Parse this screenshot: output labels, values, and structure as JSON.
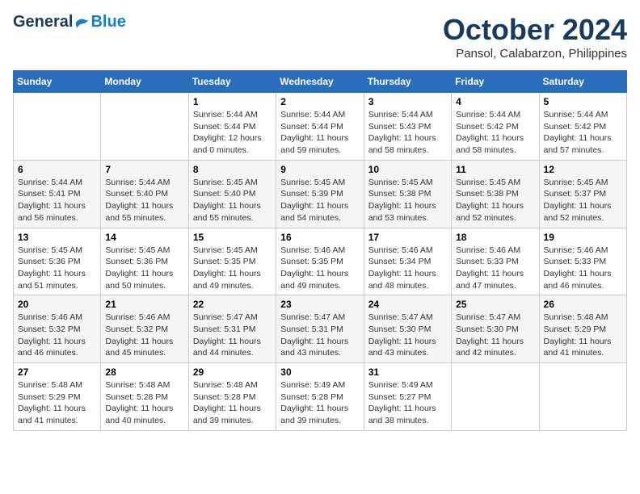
{
  "header": {
    "logo_general": "General",
    "logo_blue": "Blue",
    "month_title": "October 2024",
    "location": "Pansol, Calabarzon, Philippines"
  },
  "weekdays": [
    "Sunday",
    "Monday",
    "Tuesday",
    "Wednesday",
    "Thursday",
    "Friday",
    "Saturday"
  ],
  "weeks": [
    [
      {
        "day": "",
        "info": ""
      },
      {
        "day": "",
        "info": ""
      },
      {
        "day": "1",
        "info": "Sunrise: 5:44 AM\nSunset: 5:44 PM\nDaylight: 12 hours\nand 0 minutes."
      },
      {
        "day": "2",
        "info": "Sunrise: 5:44 AM\nSunset: 5:44 PM\nDaylight: 11 hours\nand 59 minutes."
      },
      {
        "day": "3",
        "info": "Sunrise: 5:44 AM\nSunset: 5:43 PM\nDaylight: 11 hours\nand 58 minutes."
      },
      {
        "day": "4",
        "info": "Sunrise: 5:44 AM\nSunset: 5:42 PM\nDaylight: 11 hours\nand 58 minutes."
      },
      {
        "day": "5",
        "info": "Sunrise: 5:44 AM\nSunset: 5:42 PM\nDaylight: 11 hours\nand 57 minutes."
      }
    ],
    [
      {
        "day": "6",
        "info": "Sunrise: 5:44 AM\nSunset: 5:41 PM\nDaylight: 11 hours\nand 56 minutes."
      },
      {
        "day": "7",
        "info": "Sunrise: 5:44 AM\nSunset: 5:40 PM\nDaylight: 11 hours\nand 55 minutes."
      },
      {
        "day": "8",
        "info": "Sunrise: 5:45 AM\nSunset: 5:40 PM\nDaylight: 11 hours\nand 55 minutes."
      },
      {
        "day": "9",
        "info": "Sunrise: 5:45 AM\nSunset: 5:39 PM\nDaylight: 11 hours\nand 54 minutes."
      },
      {
        "day": "10",
        "info": "Sunrise: 5:45 AM\nSunset: 5:38 PM\nDaylight: 11 hours\nand 53 minutes."
      },
      {
        "day": "11",
        "info": "Sunrise: 5:45 AM\nSunset: 5:38 PM\nDaylight: 11 hours\nand 52 minutes."
      },
      {
        "day": "12",
        "info": "Sunrise: 5:45 AM\nSunset: 5:37 PM\nDaylight: 11 hours\nand 52 minutes."
      }
    ],
    [
      {
        "day": "13",
        "info": "Sunrise: 5:45 AM\nSunset: 5:36 PM\nDaylight: 11 hours\nand 51 minutes."
      },
      {
        "day": "14",
        "info": "Sunrise: 5:45 AM\nSunset: 5:36 PM\nDaylight: 11 hours\nand 50 minutes."
      },
      {
        "day": "15",
        "info": "Sunrise: 5:45 AM\nSunset: 5:35 PM\nDaylight: 11 hours\nand 49 minutes."
      },
      {
        "day": "16",
        "info": "Sunrise: 5:46 AM\nSunset: 5:35 PM\nDaylight: 11 hours\nand 49 minutes."
      },
      {
        "day": "17",
        "info": "Sunrise: 5:46 AM\nSunset: 5:34 PM\nDaylight: 11 hours\nand 48 minutes."
      },
      {
        "day": "18",
        "info": "Sunrise: 5:46 AM\nSunset: 5:33 PM\nDaylight: 11 hours\nand 47 minutes."
      },
      {
        "day": "19",
        "info": "Sunrise: 5:46 AM\nSunset: 5:33 PM\nDaylight: 11 hours\nand 46 minutes."
      }
    ],
    [
      {
        "day": "20",
        "info": "Sunrise: 5:46 AM\nSunset: 5:32 PM\nDaylight: 11 hours\nand 46 minutes."
      },
      {
        "day": "21",
        "info": "Sunrise: 5:46 AM\nSunset: 5:32 PM\nDaylight: 11 hours\nand 45 minutes."
      },
      {
        "day": "22",
        "info": "Sunrise: 5:47 AM\nSunset: 5:31 PM\nDaylight: 11 hours\nand 44 minutes."
      },
      {
        "day": "23",
        "info": "Sunrise: 5:47 AM\nSunset: 5:31 PM\nDaylight: 11 hours\nand 43 minutes."
      },
      {
        "day": "24",
        "info": "Sunrise: 5:47 AM\nSunset: 5:30 PM\nDaylight: 11 hours\nand 43 minutes."
      },
      {
        "day": "25",
        "info": "Sunrise: 5:47 AM\nSunset: 5:30 PM\nDaylight: 11 hours\nand 42 minutes."
      },
      {
        "day": "26",
        "info": "Sunrise: 5:48 AM\nSunset: 5:29 PM\nDaylight: 11 hours\nand 41 minutes."
      }
    ],
    [
      {
        "day": "27",
        "info": "Sunrise: 5:48 AM\nSunset: 5:29 PM\nDaylight: 11 hours\nand 41 minutes."
      },
      {
        "day": "28",
        "info": "Sunrise: 5:48 AM\nSunset: 5:28 PM\nDaylight: 11 hours\nand 40 minutes."
      },
      {
        "day": "29",
        "info": "Sunrise: 5:48 AM\nSunset: 5:28 PM\nDaylight: 11 hours\nand 39 minutes."
      },
      {
        "day": "30",
        "info": "Sunrise: 5:49 AM\nSunset: 5:28 PM\nDaylight: 11 hours\nand 39 minutes."
      },
      {
        "day": "31",
        "info": "Sunrise: 5:49 AM\nSunset: 5:27 PM\nDaylight: 11 hours\nand 38 minutes."
      },
      {
        "day": "",
        "info": ""
      },
      {
        "day": "",
        "info": ""
      }
    ]
  ]
}
